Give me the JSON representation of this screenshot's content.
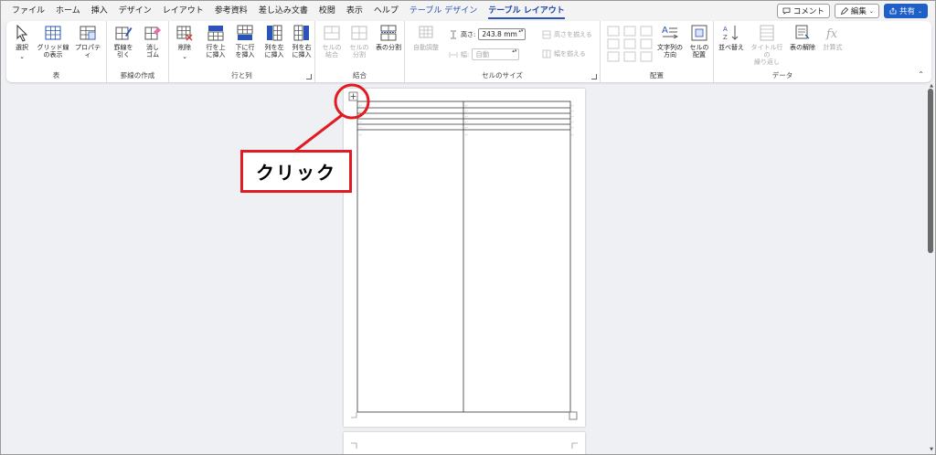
{
  "menu": {
    "tabs": [
      "ファイル",
      "ホーム",
      "挿入",
      "デザイン",
      "レイアウト",
      "参考資料",
      "差し込み文書",
      "校閲",
      "表示",
      "ヘルプ"
    ],
    "context_tabs": [
      "テーブル デザイン",
      "テーブル レイアウト"
    ],
    "active_tab": "テーブル レイアウト",
    "comment_label": "コメント",
    "edit_label": "編集",
    "share_label": "共有"
  },
  "ribbon": {
    "groups": {
      "table": "表",
      "draw": "罫線の作成",
      "rows_cols": "行と列",
      "merge": "結合",
      "cell_size": "セルのサイズ",
      "alignment": "配置",
      "data": "データ"
    },
    "buttons": {
      "select": "選択",
      "gridlines": "グリッド線\nの表示",
      "properties": "プロパティ",
      "draw_table": "罫線を\n引く",
      "eraser": "消し\nゴム",
      "delete": "削除",
      "insert_above": "行を上\nに挿入",
      "insert_below": "下に行\nを挿入",
      "insert_left": "列を左\nに挿入",
      "insert_right": "列を右\nに挿入",
      "merge_cells": "セルの\n結合",
      "split_cells": "セルの\n分割",
      "split_table": "表の分割",
      "autofit": "自動調整",
      "height_label": "高さ:",
      "height_value": "243.8 mm",
      "width_label": "幅:",
      "width_value": "自動",
      "distribute_rows": "高さを揃える",
      "distribute_cols": "幅を揃える",
      "text_direction": "文字列の\n方向",
      "cell_margins": "セルの\n配置",
      "sort": "並べ替え",
      "repeat_header": "タイトル行の\n繰り返し",
      "convert_to_text": "表の解除",
      "formula": "計算式"
    }
  },
  "annotation": {
    "callout": "クリック",
    "color": "#e11b22"
  }
}
